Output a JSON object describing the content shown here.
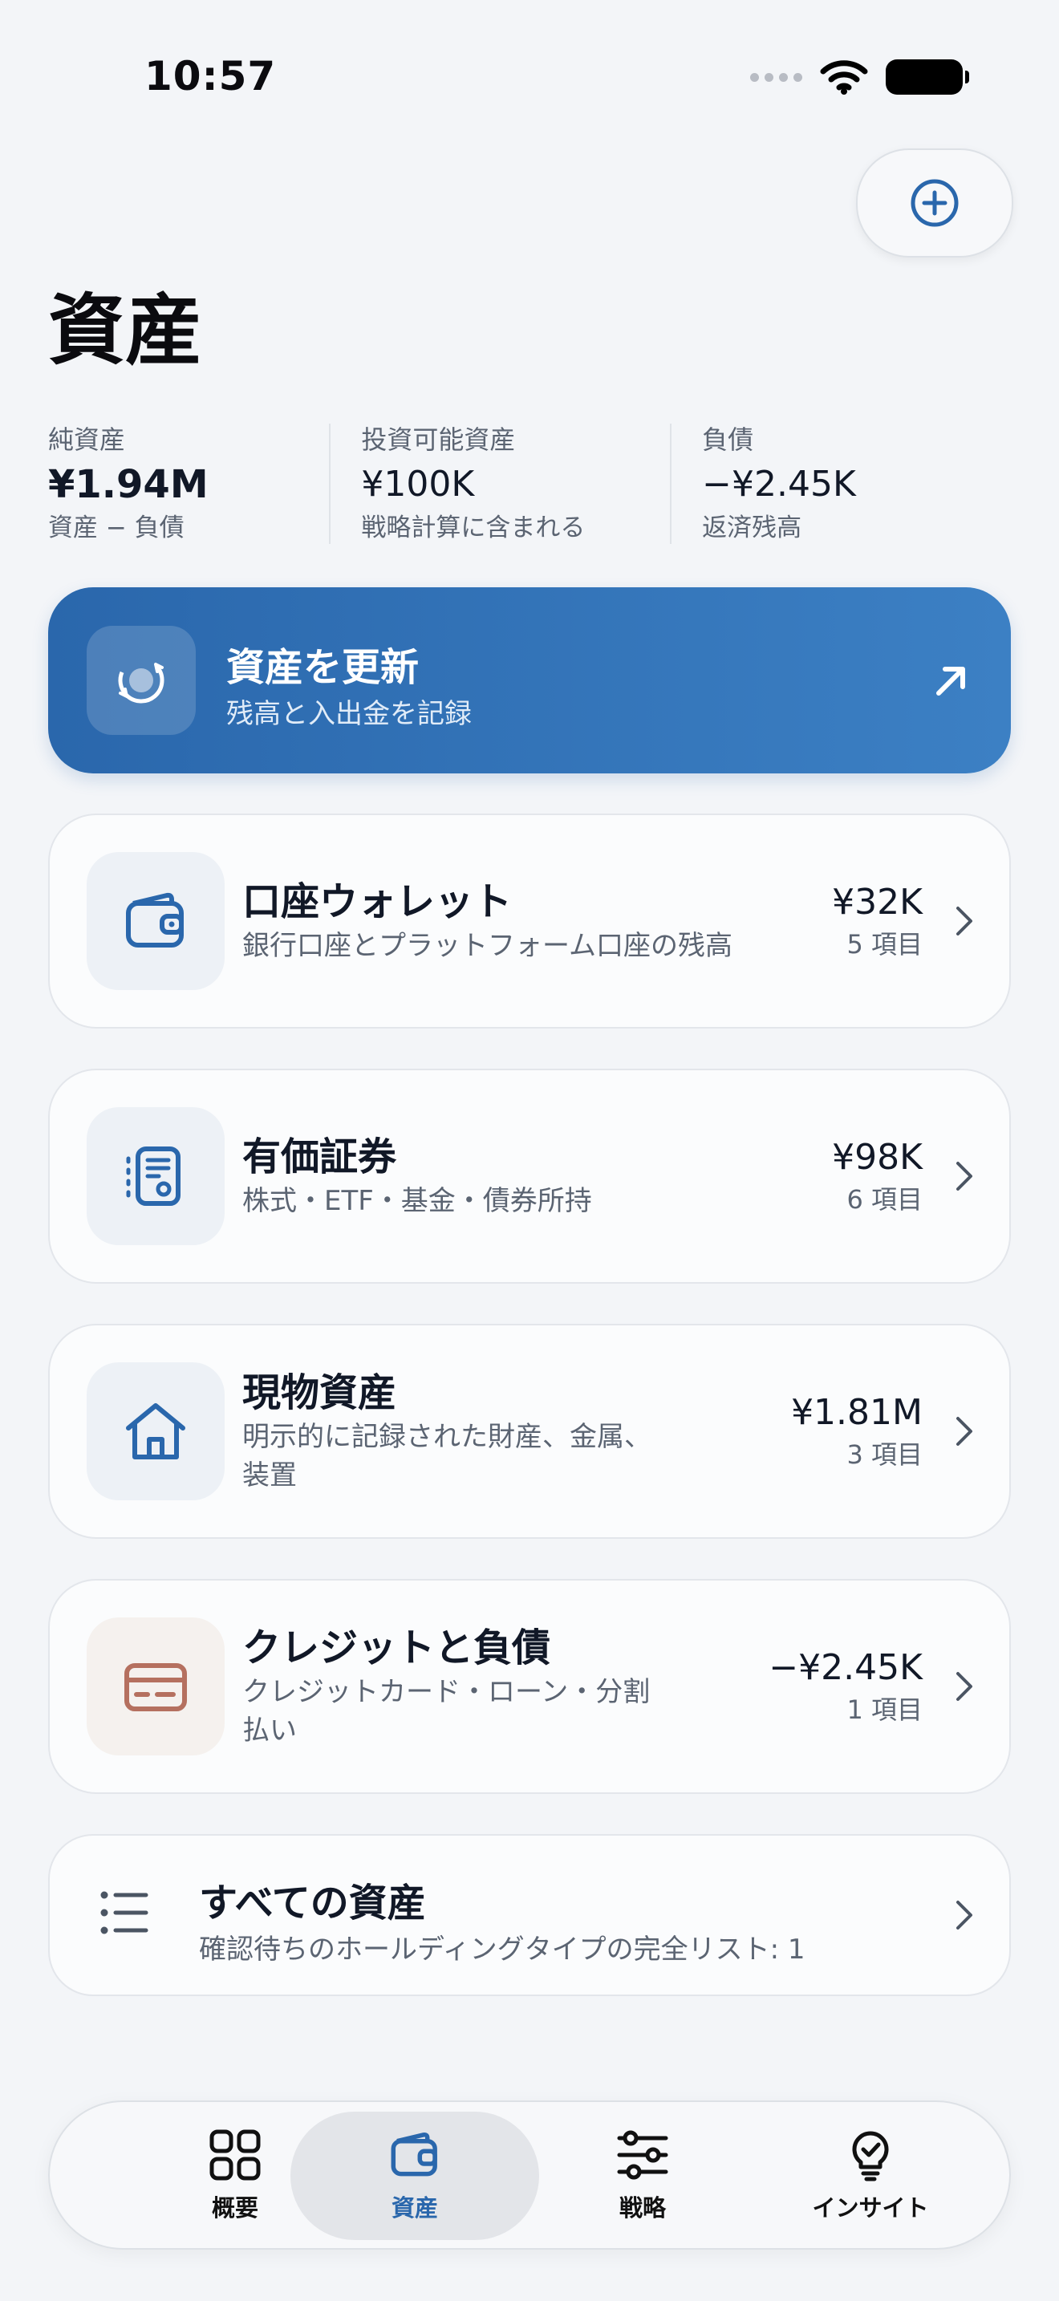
{
  "status": {
    "time": "10:57"
  },
  "header": {
    "title": "資産",
    "add_button_icon": "plus-circle-icon"
  },
  "stats": [
    {
      "label": "純資産",
      "value": "¥1.94M",
      "sub": "資産 − 負債"
    },
    {
      "label": "投資可能資産",
      "value": "¥100K",
      "sub": "戦略計算に含まれる"
    },
    {
      "label": "負債",
      "value": "−¥2.45K",
      "sub": "返済残高"
    }
  ],
  "update_card": {
    "title": "資産を更新",
    "subtitle": "残高と入出金を記録",
    "icon": "sync-icon",
    "arrow_icon": "arrow-up-right-icon"
  },
  "categories": [
    {
      "title": "口座ウォレット",
      "subtitle": "銀行口座とプラットフォーム口座の残高",
      "amount": "¥32K",
      "count": "5 項目",
      "icon": "wallet-icon"
    },
    {
      "title": "有価証券",
      "subtitle": "株式・ETF・基金・債券所持",
      "amount": "¥98K",
      "count": "6 項目",
      "icon": "document-icon"
    },
    {
      "title": "現物資産",
      "subtitle": "明示的に記録された財産、金属、装置",
      "amount": "¥1.81M",
      "count": "3 項目",
      "icon": "house-icon"
    },
    {
      "title": "クレジットと負債",
      "subtitle": "クレジットカード・ローン・分割払い",
      "amount": "−¥2.45K",
      "count": "1 項目",
      "icon": "credit-card-icon"
    }
  ],
  "all_assets": {
    "title": "すべての資産",
    "subtitle": "確認待ちのホールディングタイプの完全リスト: 1",
    "icon": "list-icon"
  },
  "tabs": [
    {
      "label": "概要",
      "icon": "grid-icon",
      "active": false
    },
    {
      "label": "資産",
      "icon": "wallet-icon",
      "active": true
    },
    {
      "label": "戦略",
      "icon": "sliders-icon",
      "active": false
    },
    {
      "label": "インサイト",
      "icon": "lightbulb-icon",
      "active": false
    }
  ],
  "colors": {
    "accent": "#2a67ac",
    "liability": "#b5705f",
    "background": "#f3f5f8"
  }
}
